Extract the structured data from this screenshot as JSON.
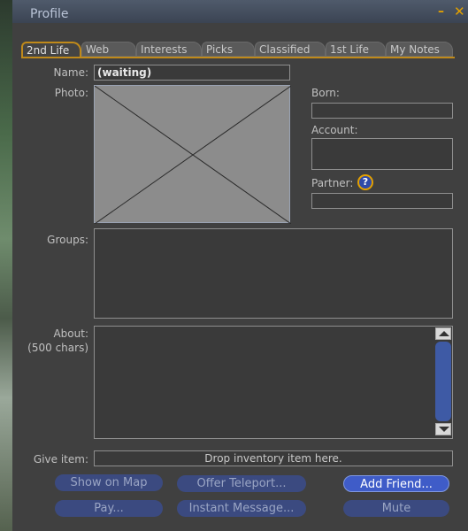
{
  "window": {
    "title": "Profile"
  },
  "tabs": [
    "2nd Life",
    "Web",
    "Interests",
    "Picks",
    "Classified",
    "1st Life",
    "My Notes"
  ],
  "fields": {
    "name_label": "Name:",
    "name_value": "(waiting)",
    "photo_label": "Photo:",
    "born_label": "Born:",
    "account_label": "Account:",
    "partner_label": "Partner:",
    "groups_label": "Groups:",
    "about_label": "About:",
    "about_hint": "(500 chars)",
    "give_item_label": "Give item:",
    "give_item_drop": "Drop inventory item here."
  },
  "buttons": {
    "show_on_map": "Show on Map",
    "offer_teleport": "Offer Teleport...",
    "add_friend": "Add Friend...",
    "pay": "Pay...",
    "instant_message": "Instant Message...",
    "mute": "Mute",
    "help": "?"
  },
  "colors": {
    "accent": "#c08a1a",
    "button": "#3b4a80",
    "button_primary": "#3f5cc8",
    "panel": "#404040"
  }
}
